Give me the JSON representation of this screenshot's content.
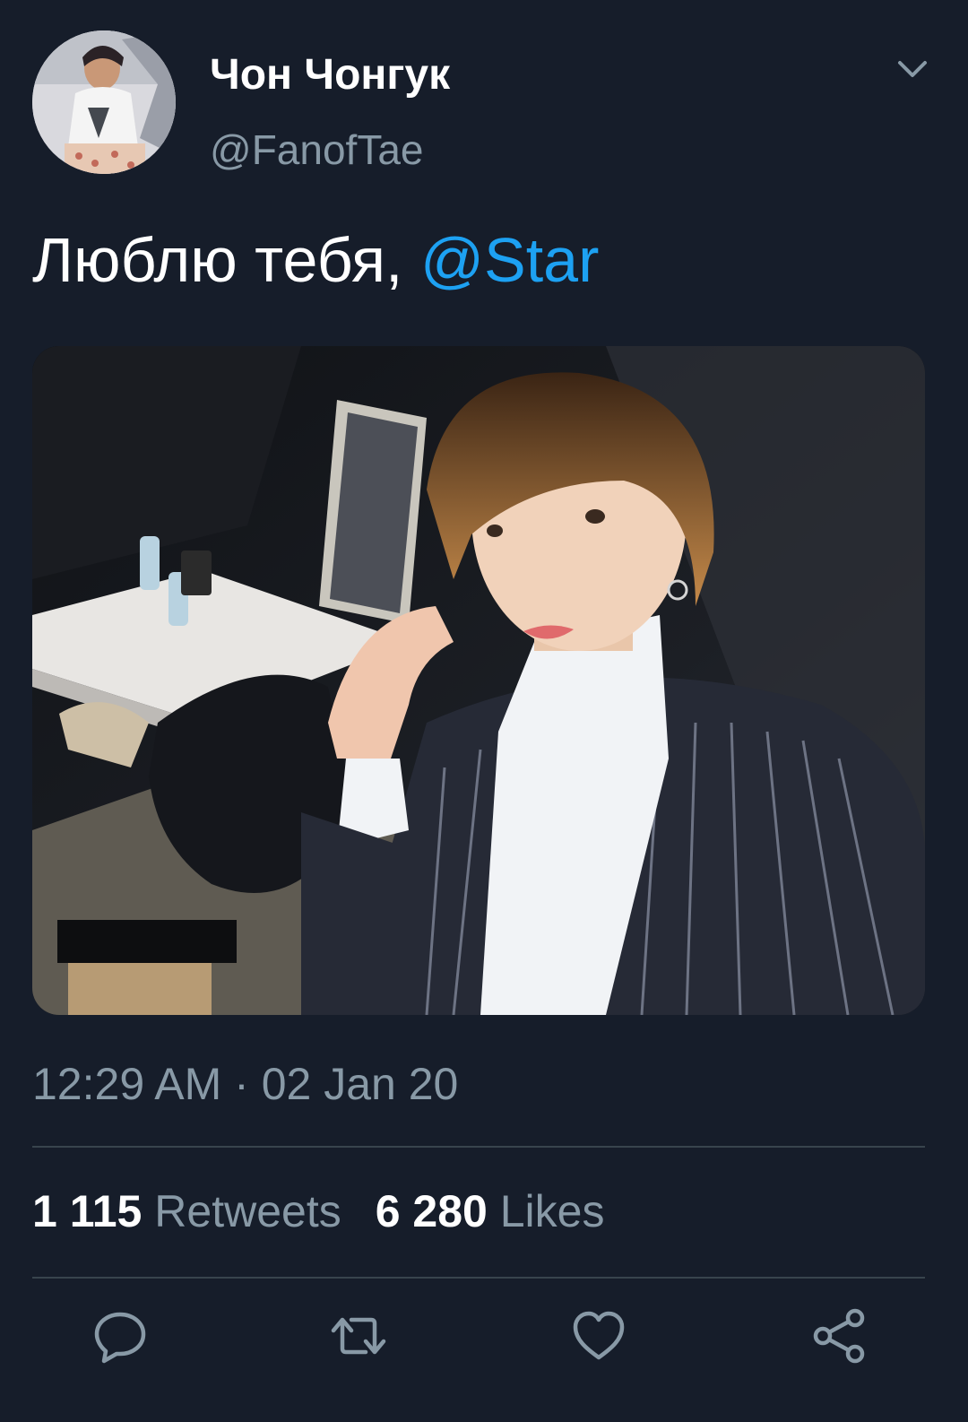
{
  "user": {
    "display_name": "Чон Чонгук",
    "handle": "@FanofTae",
    "avatar_icon": "profile-photo"
  },
  "tweet": {
    "text": "Люблю тебя, ",
    "mention": "@Star",
    "timestamp": "12:29 AM · 02 Jan 20"
  },
  "stats": {
    "retweets_count": "1 115",
    "retweets_label": "Retweets",
    "likes_count": "6 280",
    "likes_label": "Likes"
  },
  "actions": {
    "reply_icon": "reply-icon",
    "retweet_icon": "retweet-icon",
    "like_icon": "heart-icon",
    "share_icon": "share-icon"
  },
  "colors": {
    "background": "#161d2a",
    "accent": "#1da1f2",
    "secondary_text": "#8899a6",
    "divider": "#38444d"
  }
}
